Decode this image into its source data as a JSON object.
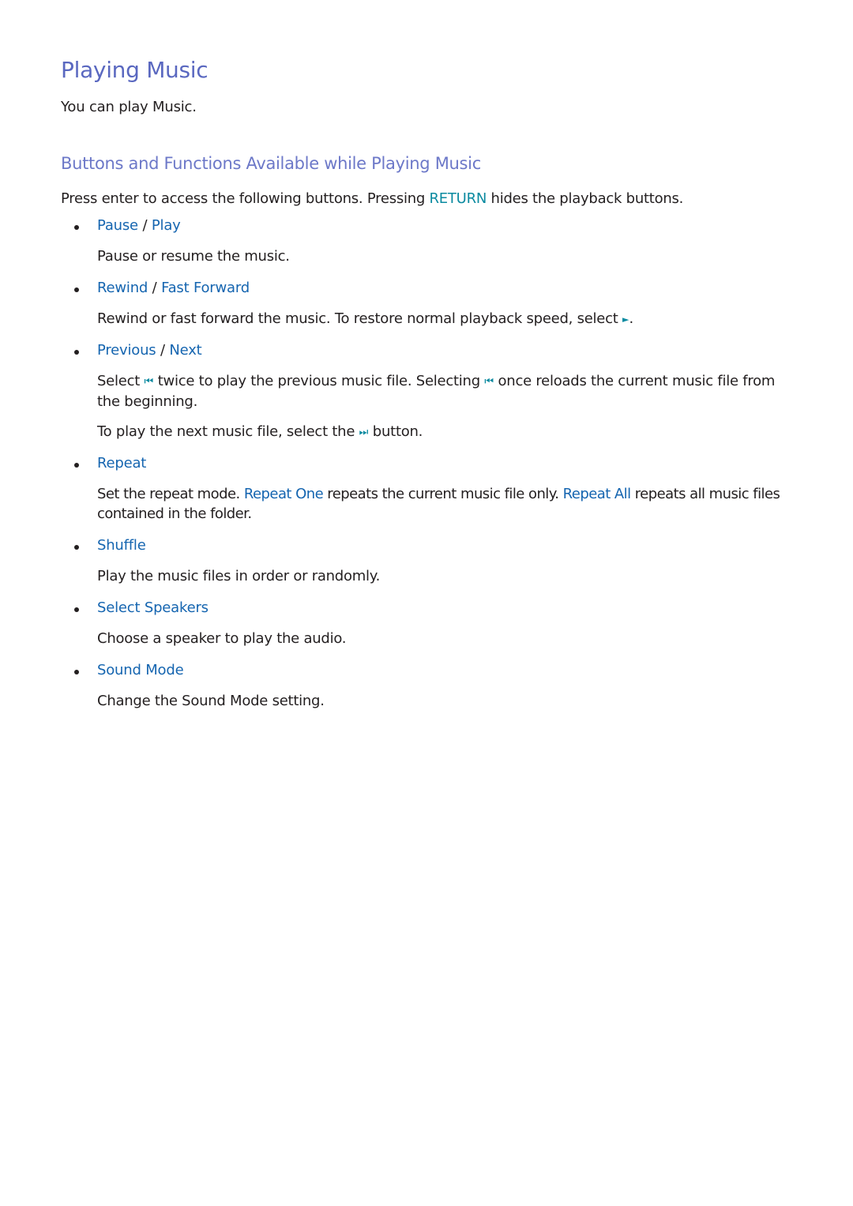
{
  "page_title": "Playing Music",
  "intro": "You can play Music.",
  "section": {
    "title": "Buttons and Functions Available while Playing Music",
    "lead_before": "Press enter to access the following buttons. Pressing ",
    "lead_key": "RETURN",
    "lead_after": " hides the playback buttons."
  },
  "items": [
    {
      "title_a": "Pause",
      "sep": " / ",
      "title_b": "Play",
      "desc": "Pause or resume the music."
    },
    {
      "title_a": "Rewind",
      "sep": " / ",
      "title_b": "Fast Forward",
      "desc_before": "Rewind or fast forward the music. To restore normal playback speed, select ",
      "desc_icon": "play-icon",
      "desc_icon_glyph": "►",
      "desc_after": "."
    },
    {
      "title_a": "Previous",
      "sep": " / ",
      "title_b": "Next",
      "p1_a": "Select ",
      "p1_icon_glyph": "⏮",
      "p1_b": " twice to play the previous music file. Selecting ",
      "p1_c": " once reloads the current music file from the beginning.",
      "p2_a": "To play the next music file, select the ",
      "p2_icon_glyph": "⏭",
      "p2_b": " button."
    },
    {
      "title": "Repeat",
      "desc_a": "Set the repeat mode. ",
      "desc_k1": "Repeat One",
      "desc_b": " repeats the current music file only. ",
      "desc_k2": "Repeat All",
      "desc_c": " repeats all music files contained in the folder."
    },
    {
      "title": "Shuffle",
      "desc": "Play the music files in order or randomly."
    },
    {
      "title": "Select Speakers",
      "desc": "Choose a speaker to play the audio."
    },
    {
      "title": "Sound Mode",
      "desc": "Change the Sound Mode setting."
    }
  ],
  "colors": {
    "title": "#5a68c0",
    "subtitle": "#6c78c8",
    "link": "#1565b0",
    "key": "#0a8aa0",
    "text": "#231f20"
  }
}
